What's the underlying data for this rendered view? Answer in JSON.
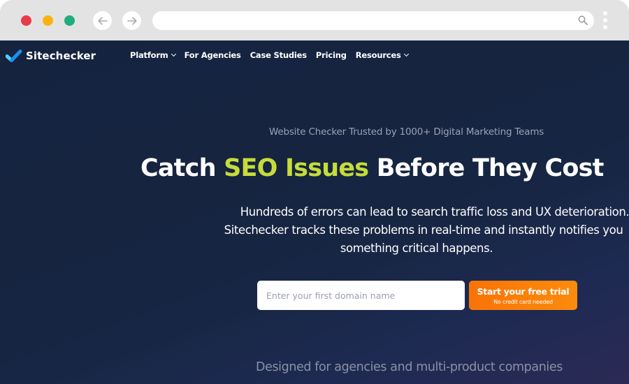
{
  "browser": {
    "nav_back_icon": "arrow-left-icon",
    "nav_forward_icon": "arrow-right-icon",
    "address_value": "",
    "search_icon": "search-icon",
    "menu_icon": "kebab-menu-icon",
    "window_controls": [
      {
        "name": "close",
        "color": "#e83a4a"
      },
      {
        "name": "minimize",
        "color": "#fbb20f"
      },
      {
        "name": "maximize",
        "color": "#1fae7d"
      }
    ]
  },
  "header": {
    "brand": "Sitechecker",
    "logo_icon": "checkmark-logo-icon",
    "menu": [
      {
        "label": "Platform",
        "has_dropdown": true
      },
      {
        "label": "For Agencies",
        "has_dropdown": false
      },
      {
        "label": "Case Studies",
        "has_dropdown": false
      },
      {
        "label": "Pricing",
        "has_dropdown": false
      },
      {
        "label": "Resources",
        "has_dropdown": true
      }
    ]
  },
  "hero": {
    "tagline": "Website Checker Trusted by 1000+ Digital Marketing Teams",
    "headline_pre": "Catch ",
    "headline_accent": "SEO Issues",
    "headline_post": " Before They Cost",
    "description_lines": [
      "Hundreds of errors can lead to search traffic loss and UX deterioration.",
      "Sitechecker tracks these problems in real-time and instantly notifies you",
      "something critical happens."
    ],
    "domain_input": {
      "value": "",
      "placeholder": "Enter your first domain name"
    },
    "cta": {
      "label": "Start your free trial",
      "sublabel": "No credit card needed"
    },
    "designed_for": "Designed for agencies and multi-product companies"
  },
  "colors": {
    "page_bg": "#15233f",
    "accent_green": "#c6dc3a",
    "cta_orange": "#f97308",
    "logo_blue": "#1fa8f5"
  }
}
